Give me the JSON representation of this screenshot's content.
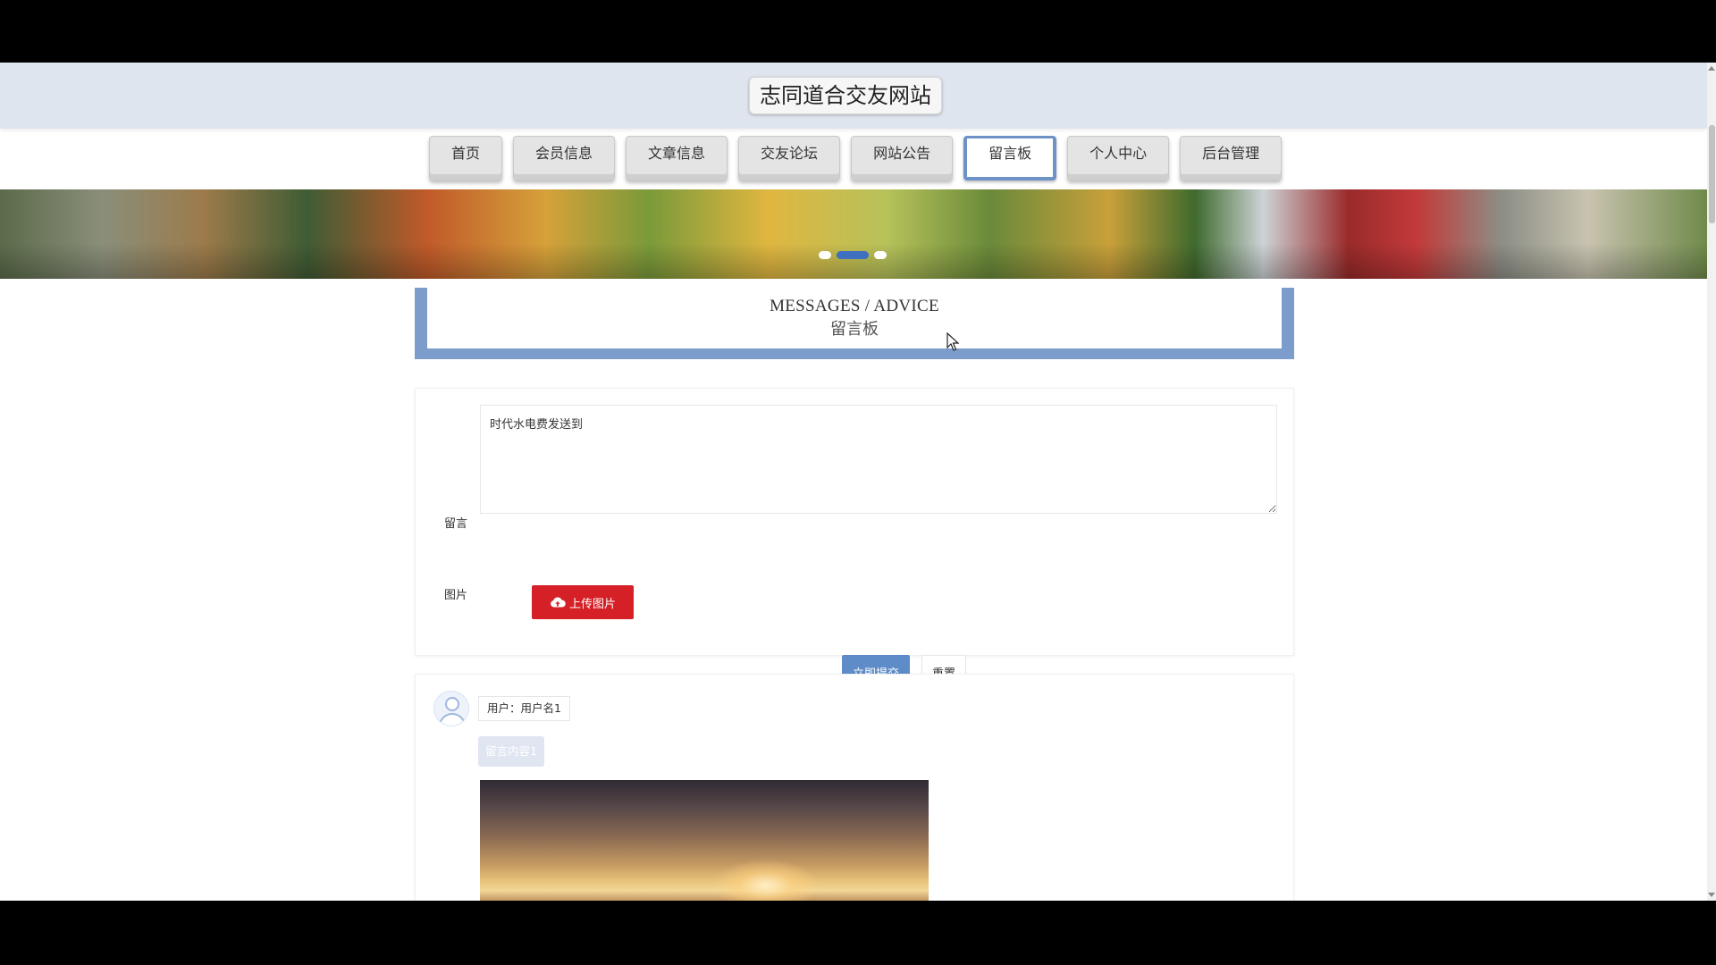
{
  "site": {
    "title": "志同道合交友网站"
  },
  "nav": {
    "items": [
      {
        "label": "首页",
        "active": false
      },
      {
        "label": "会员信息",
        "active": false
      },
      {
        "label": "文章信息",
        "active": false
      },
      {
        "label": "交友论坛",
        "active": false
      },
      {
        "label": "网站公告",
        "active": false
      },
      {
        "label": "留言板",
        "active": true
      },
      {
        "label": "个人中心",
        "active": false
      },
      {
        "label": "后台管理",
        "active": false
      }
    ]
  },
  "banner": {
    "dots": 3,
    "active_dot": 1
  },
  "section": {
    "title_en": "MESSAGES / ADVICE",
    "title_cn": "留言板"
  },
  "form": {
    "message_label": "留言",
    "message_value": "时代水电费发送到",
    "image_label": "图片",
    "upload_label": "上传图片",
    "submit_label": "立即提交",
    "reset_label": "重置"
  },
  "comments": [
    {
      "user": "用户：用户名1",
      "content": "留言内容1"
    }
  ],
  "colors": {
    "accent": "#7c9ccc",
    "primary_button": "#5d8cc9",
    "upload_button": "#d42026",
    "header_bg": "#dfe5ee"
  },
  "icons": {
    "upload": "cloud-upload-icon",
    "avatar": "user-avatar-icon"
  }
}
